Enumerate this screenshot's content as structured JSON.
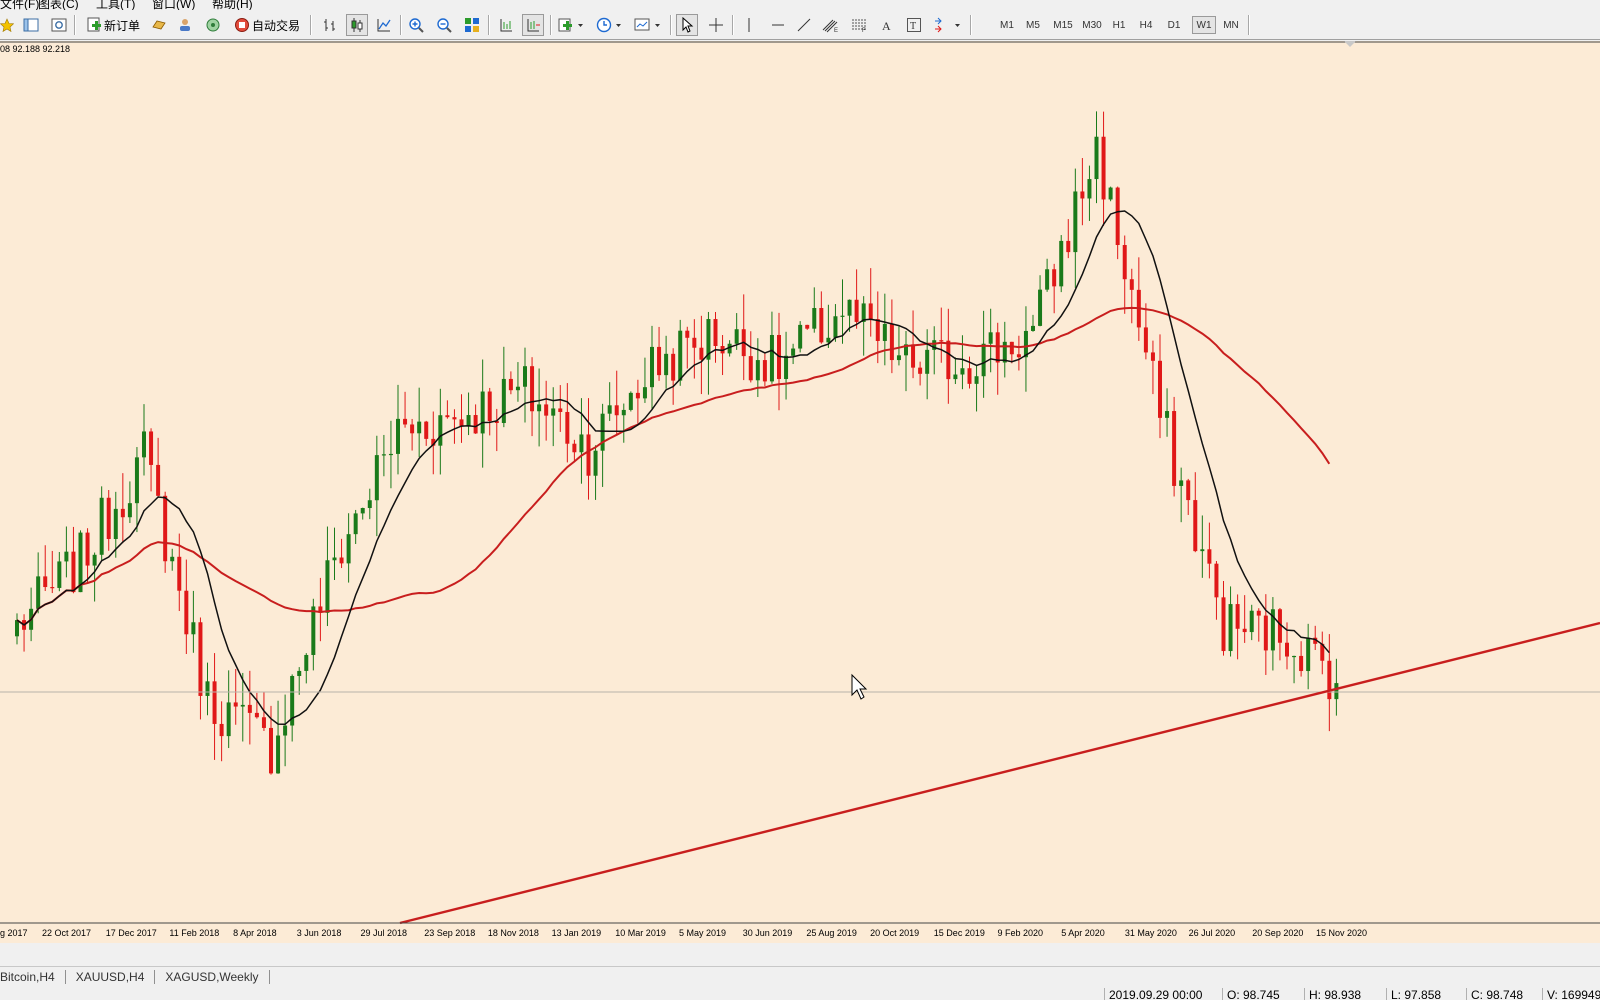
{
  "menu": {
    "items": [
      "文件(F)",
      "图表(C)",
      "工具(T)",
      "窗口(W)",
      "帮助(H)"
    ]
  },
  "toolbar": {
    "new_order_label": "新订单",
    "auto_trade_label": "自动交易",
    "timeframes": [
      "M1",
      "M5",
      "M15",
      "M30",
      "H1",
      "H4",
      "D1",
      "W1",
      "MN"
    ],
    "active_timeframe": "W1"
  },
  "chart": {
    "ohlc_readout": "08 92.188 92.218",
    "background_color": "#fcebd6",
    "up_candle_color": "#1a7a1a",
    "down_candle_color": "#e01818",
    "x_labels": [
      "g 2017",
      "22 Oct 2017",
      "17 Dec 2017",
      "11 Feb 2018",
      "8 Apr 2018",
      "3 Jun 2018",
      "29 Jul 2018",
      "23 Sep 2018",
      "18 Nov 2018",
      "13 Jan 2019",
      "10 Mar 2019",
      "5 May 2019",
      "30 Jun 2019",
      "25 Aug 2019",
      "20 Oct 2019",
      "15 Dec 2019",
      "9 Feb 2020",
      "5 Apr 2020",
      "31 May 2020",
      "26 Jul 2020",
      "20 Sep 2020",
      "15 Nov 2020"
    ],
    "indicators": [
      {
        "color": "#111111"
      },
      {
        "color": "#c81e1e"
      }
    ],
    "trendline_color": "#c81e1e"
  },
  "chart_data": {
    "type": "candlestick",
    "x": [
      "g 2017",
      "22 Oct 2017",
      "17 Dec 2017",
      "11 Feb 2018",
      "8 Apr 2018",
      "3 Jun 2018",
      "29 Jul 2018",
      "23 Sep 2018",
      "18 Nov 2018",
      "13 Jan 2019",
      "10 Mar 2019",
      "5 May 2019",
      "30 Jun 2019",
      "25 Aug 2019",
      "20 Oct 2019",
      "15 Dec 2019",
      "9 Feb 2020",
      "5 Apr 2020",
      "31 May 2020",
      "26 Jul 2020",
      "20 Sep 2020",
      "15 Nov 2020"
    ],
    "path_close": [
      0.34,
      0.42,
      0.55,
      0.25,
      0.19,
      0.42,
      0.58,
      0.6,
      0.63,
      0.56,
      0.66,
      0.7,
      0.66,
      0.73,
      0.66,
      0.67,
      0.7,
      0.93,
      0.6,
      0.34,
      0.33,
      0.26
    ],
    "grid": false,
    "legend": "none"
  },
  "tabs": [
    "Bitcoin,H4",
    "XAUUSD,H4",
    "XAGUSD,Weekly"
  ],
  "status": {
    "datetime": "2019.09.29 00:00",
    "open": "O: 98.745",
    "high": "H: 98.938",
    "low": "L: 97.858",
    "close": "C: 98.748",
    "volume": "V: 169949"
  }
}
